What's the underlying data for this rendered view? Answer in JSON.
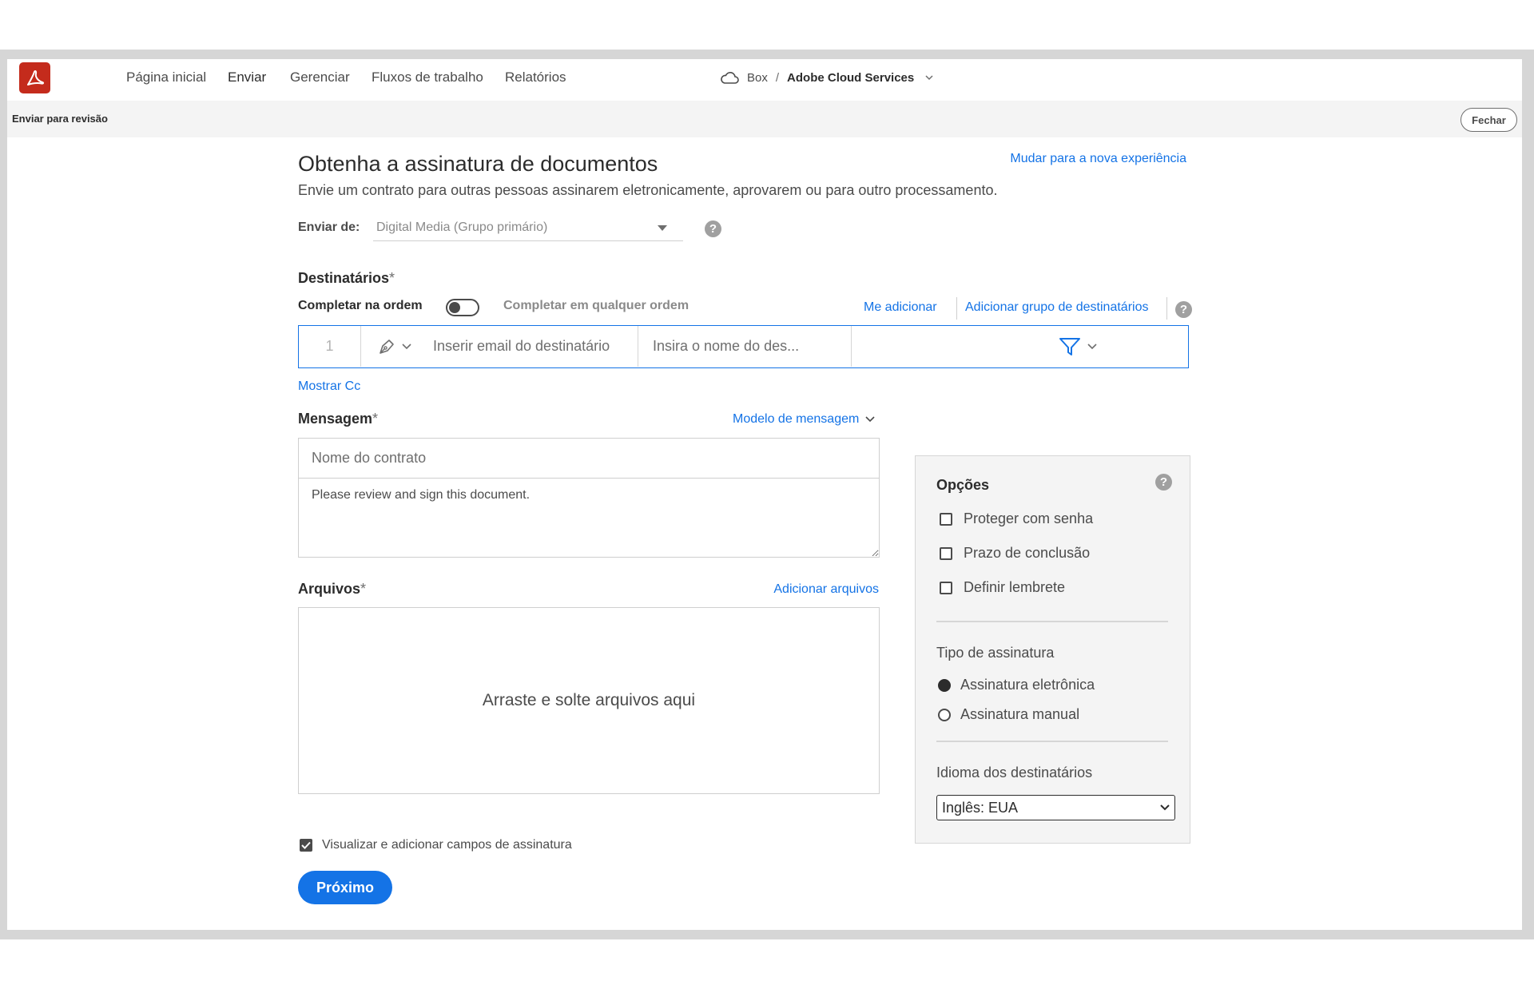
{
  "nav": {
    "items": [
      {
        "label": "Página inicial"
      },
      {
        "label": "Enviar"
      },
      {
        "label": "Gerenciar"
      },
      {
        "label": "Fluxos de trabalho"
      },
      {
        "label": "Relatórios"
      }
    ],
    "active": "Enviar"
  },
  "breadcrumb": {
    "root": "Box",
    "separator": "/",
    "current": "Adobe Cloud Services"
  },
  "subheader": {
    "title": "Enviar para revisão",
    "close_label": "Fechar"
  },
  "page": {
    "title": "Obtenha a assinatura de documentos",
    "subtitle": "Envie um contrato para outras pessoas assinarem eletronicamente, aprovarem ou para outro processamento.",
    "switch_experience": "Mudar para a nova experiência"
  },
  "send_from": {
    "label": "Enviar de:",
    "value": "Digital Media (Grupo primário)",
    "help": "?"
  },
  "recipients": {
    "label": "Destinatários",
    "required_mark": "*",
    "order_label": "Completar na ordem",
    "any_order_label": "Completar em qualquer ordem",
    "add_me": "Me adicionar",
    "add_group": "Adicionar grupo de destinatários",
    "help": "?",
    "row": {
      "number": "1",
      "email_placeholder": "Inserir email do destinatário",
      "name_placeholder": "Insira o nome do des..."
    },
    "show_cc": "Mostrar Cc"
  },
  "message": {
    "label": "Mensagem",
    "required_mark": "*",
    "template_link": "Modelo de mensagem",
    "contract_name_placeholder": "Nome do contrato",
    "body": "Please review and sign this document."
  },
  "files": {
    "label": "Arquivos",
    "required_mark": "*",
    "add_files": "Adicionar arquivos",
    "drop_text": "Arraste e solte arquivos aqui"
  },
  "preview": {
    "label": "Visualizar e adicionar campos de assinatura",
    "checked": true
  },
  "next_button": "Próximo",
  "options": {
    "title": "Opções",
    "help": "?",
    "checkboxes": [
      {
        "label": "Proteger com senha",
        "checked": false
      },
      {
        "label": "Prazo de conclusão",
        "checked": false
      },
      {
        "label": "Definir lembrete",
        "checked": false
      }
    ],
    "signature_type": {
      "label": "Tipo de assinatura",
      "options": [
        {
          "label": "Assinatura eletrônica",
          "selected": true
        },
        {
          "label": "Assinatura manual",
          "selected": false
        }
      ]
    },
    "language": {
      "label": "Idioma dos destinatários",
      "value": "Inglês: EUA"
    }
  },
  "colors": {
    "accent": "#1473e6",
    "brand": "#c42b1c",
    "panel_bg": "#f4f4f4"
  }
}
